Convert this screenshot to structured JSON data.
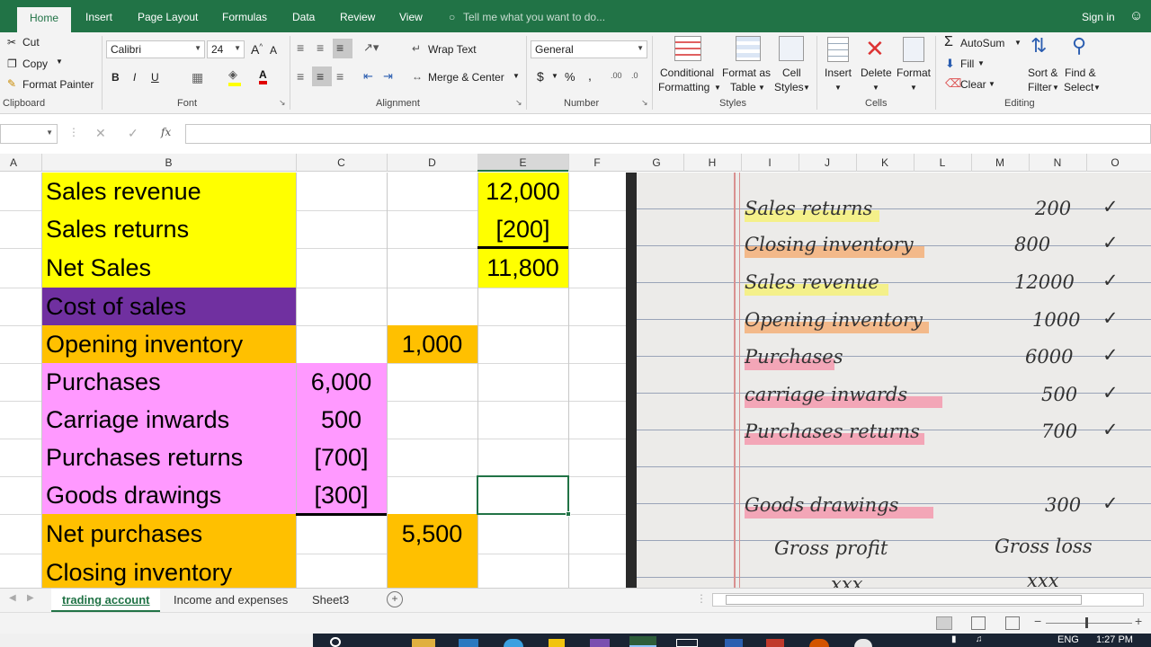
{
  "ribbon_tabs": [
    "Home",
    "Insert",
    "Page Layout",
    "Formulas",
    "Data",
    "Review",
    "View"
  ],
  "tell_me": "Tell me what you want to do...",
  "sign_in": "Sign in",
  "clipboard": {
    "cut": "Cut",
    "copy": "Copy",
    "format_painter": "Format Painter",
    "label": "Clipboard"
  },
  "font": {
    "name": "Calibri",
    "size": "24",
    "label": "Font",
    "bold": "B",
    "italic": "I",
    "underline": "U"
  },
  "alignment": {
    "wrap_text": "Wrap Text",
    "merge_center": "Merge & Center",
    "label": "Alignment"
  },
  "number": {
    "format": "General",
    "currency": "$",
    "percent": "%",
    "comma": ",",
    "label": "Number"
  },
  "styles": {
    "conditional": "Conditional",
    "formatting": "Formatting",
    "format_as": "Format as",
    "table": "Table",
    "cell": "Cell",
    "styles_word": "Styles",
    "label": "Styles"
  },
  "cells": {
    "insert": "Insert",
    "delete": "Delete",
    "format": "Format",
    "label": "Cells"
  },
  "editing": {
    "autosum": "AutoSum",
    "fill": "Fill",
    "clear": "Clear",
    "sort_filter_1": "Sort &",
    "sort_filter_2": "Filter",
    "find_select_1": "Find &",
    "find_select_2": "Select",
    "label": "Editing"
  },
  "formula_fx": "fx",
  "columns_left": [
    "A",
    "B",
    "C",
    "D",
    "E",
    "F"
  ],
  "columns_right": [
    "G",
    "H",
    "I",
    "J",
    "K",
    "L",
    "M",
    "N",
    "O"
  ],
  "rows": [
    {
      "label": "Sales revenue",
      "c": "",
      "d": "",
      "e": "12,000",
      "bcolor": "#ffff00",
      "dcolor": "",
      "ecolor": "#ffff00"
    },
    {
      "label": "Sales returns",
      "c": "",
      "d": "",
      "e": "[200]",
      "bcolor": "#ffff00",
      "dcolor": "",
      "ecolor": "#ffff00"
    },
    {
      "label": "Net Sales",
      "c": "",
      "d": "",
      "e": "11,800",
      "bcolor": "#ffff00",
      "dcolor": "",
      "ecolor": "#ffff00"
    },
    {
      "label": "Cost of sales",
      "c": "",
      "d": "",
      "e": "",
      "bcolor": "#7030a0",
      "dcolor": "",
      "ecolor": ""
    },
    {
      "label": "Opening inventory",
      "c": "",
      "d": "1,000",
      "e": "",
      "bcolor": "#ffc000",
      "dcolor": "#ffc000",
      "ecolor": ""
    },
    {
      "label": "Purchases",
      "c": "6,000",
      "d": "",
      "e": "",
      "bcolor": "#ff99ff",
      "ccolor": "#ff99ff",
      "dcolor": "",
      "ecolor": ""
    },
    {
      "label": "Carriage inwards",
      "c": "500",
      "d": "",
      "e": "",
      "bcolor": "#ff99ff",
      "ccolor": "#ff99ff",
      "dcolor": "",
      "ecolor": ""
    },
    {
      "label": "Purchases returns",
      "c": "[700]",
      "d": "",
      "e": "",
      "bcolor": "#ff99ff",
      "ccolor": "#ff99ff",
      "dcolor": "",
      "ecolor": ""
    },
    {
      "label": "Goods drawings",
      "c": "[300]",
      "d": "",
      "e": "",
      "bcolor": "#ff99ff",
      "ccolor": "#ff99ff",
      "dcolor": "",
      "ecolor": ""
    },
    {
      "label": "Net purchases",
      "c": "",
      "d": "5,500",
      "e": "",
      "bcolor": "#ffc000",
      "dcolor": "#ffc000",
      "ecolor": ""
    },
    {
      "label": "Closing inventory",
      "c": "",
      "d": "",
      "e": "",
      "bcolor": "#ffc000",
      "dcolor": "#ffc000",
      "ecolor": ""
    }
  ],
  "notes": [
    {
      "text": "Sales returns",
      "val": "200",
      "mark": "#f7f26a"
    },
    {
      "text": "Closing inventory",
      "val": "800",
      "mark": "#f6a86a"
    },
    {
      "text": "Sales revenue",
      "val": "12000",
      "mark": "#f7f26a"
    },
    {
      "text": "Opening inventory",
      "val": "1000",
      "mark": "#f6a86a"
    },
    {
      "text": "Purchases",
      "val": "6000",
      "mark": "#f58fa6"
    },
    {
      "text": "carriage inwards",
      "val": "500",
      "mark": "#f58fa6"
    },
    {
      "text": "Purchases returns",
      "val": "700",
      "mark": "#f58fa6"
    },
    {
      "text": "Goods drawings",
      "val": "300",
      "mark": "#f58fa6"
    }
  ],
  "note_footer": {
    "gp": "Gross profit",
    "gl": "Gross loss",
    "xl": "xxx",
    "xr": "xxx"
  },
  "sheet_tabs": [
    "trading account",
    "Income and expenses",
    "Sheet3"
  ],
  "taskbar": {
    "lang": "ENG",
    "time": "1:27 PM"
  }
}
